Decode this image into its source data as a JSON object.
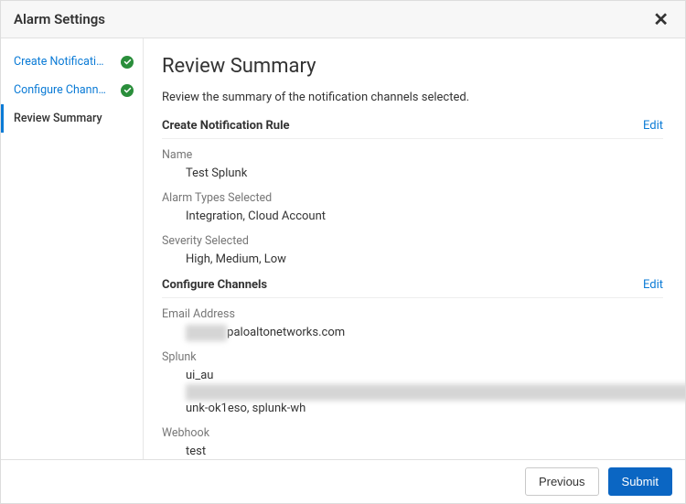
{
  "header": {
    "title": "Alarm Settings"
  },
  "sidebar": {
    "steps": [
      {
        "label": "Create Notification ...",
        "done": true
      },
      {
        "label": "Configure Channels",
        "done": true
      },
      {
        "label": "Review Summary",
        "done": false
      }
    ]
  },
  "main": {
    "title": "Review Summary",
    "description": "Review the summary of the notification channels selected.",
    "edit_label": "Edit",
    "rule_section": {
      "title": "Create Notification Rule",
      "name_label": "Name",
      "name_value": "Test Splunk",
      "types_label": "Alarm Types Selected",
      "types_value": "Integration, Cloud Account",
      "severity_label": "Severity Selected",
      "severity_value": "High, Medium, Low"
    },
    "channels_section": {
      "title": "Configure Channels",
      "email_label": "Email Address",
      "email_redacted": "xxxxxxx",
      "email_domain": "paloaltonetworks.com",
      "splunk_label": "Splunk",
      "splunk_prefix": "ui_au",
      "splunk_redacted": "xxxxxxxxxxxxxxxxxxxxxxxxxxxxxxxxxxxxxxxxxxxxxxxxxxxxxxxxxxxxxxxxxxxxxxxxxxxxxxxxxxxxxxxxxxxxxxxxxxxxxxxxxxxxxxxxxxxxxxxxxxxx",
      "splunk_suffix": "unk-ok1eso, splunk-wh",
      "webhook_label": "Webhook",
      "webhook_value": "test"
    }
  },
  "footer": {
    "previous": "Previous",
    "submit": "Submit"
  }
}
